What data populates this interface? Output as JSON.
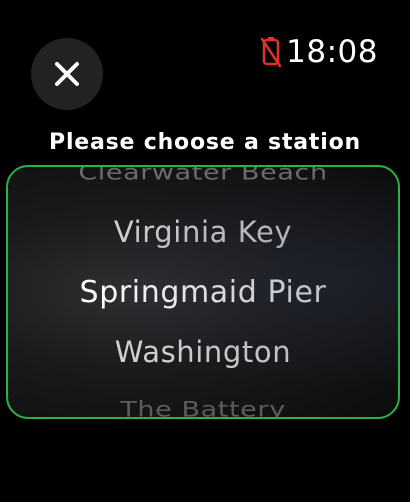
{
  "close_icon": "close-icon",
  "status": {
    "battery_icon": "battery-disconnected-icon",
    "battery_icon_color": "#e0312b",
    "time": "18:08"
  },
  "title": "Please choose a station",
  "picker": {
    "border_color": "#27b24a",
    "stations": [
      "Clearwater Beach",
      "Virginia Key",
      "Springmaid Pier",
      "Washington",
      "The Battery"
    ],
    "selected": "Springmaid Pier"
  }
}
